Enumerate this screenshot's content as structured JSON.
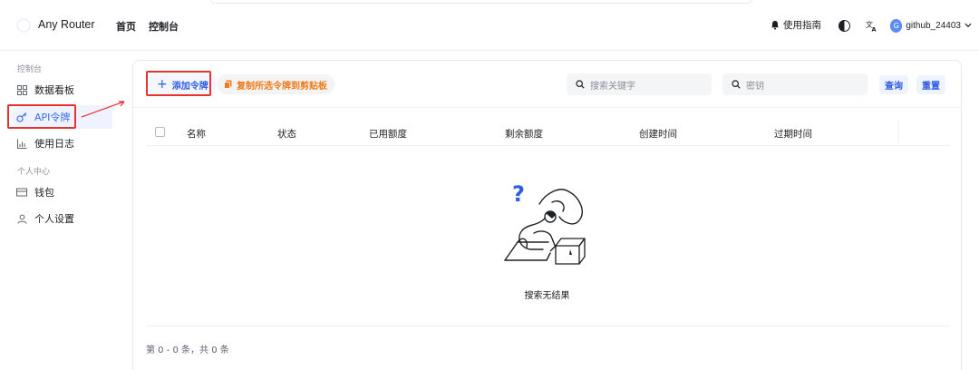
{
  "header": {
    "app_name": "Any Router",
    "nav": [
      "首页",
      "控制台"
    ],
    "guide_label": "使用指南",
    "username": "github_24403",
    "avatar_letter": "G"
  },
  "sidebar": {
    "section_console": "控制台",
    "section_personal": "个人中心",
    "items": [
      {
        "label": "数据看板",
        "icon": "dashboard-grid-icon"
      },
      {
        "label": "API令牌",
        "icon": "key-icon"
      },
      {
        "label": "使用日志",
        "icon": "bar-chart-icon"
      },
      {
        "label": "钱包",
        "icon": "wallet-icon"
      },
      {
        "label": "个人设置",
        "icon": "user-icon"
      }
    ]
  },
  "toolbar": {
    "add_label": "添加令牌",
    "copy_label": "复制所选令牌到剪贴板",
    "search_keyword_placeholder": "搜索关键字",
    "search_key_placeholder": "密钥",
    "query_label": "查询",
    "reset_label": "重置"
  },
  "table": {
    "columns": [
      "名称",
      "状态",
      "已用额度",
      "剩余额度",
      "创建时间",
      "过期时间"
    ]
  },
  "empty": {
    "message": "搜索无结果"
  },
  "pagination": {
    "summary": "第 0 - 0 条，共 0 条"
  },
  "colors": {
    "accent": "#2e5ce6",
    "copy_orange": "#ef7c1e",
    "highlight_red": "#e8322d"
  }
}
